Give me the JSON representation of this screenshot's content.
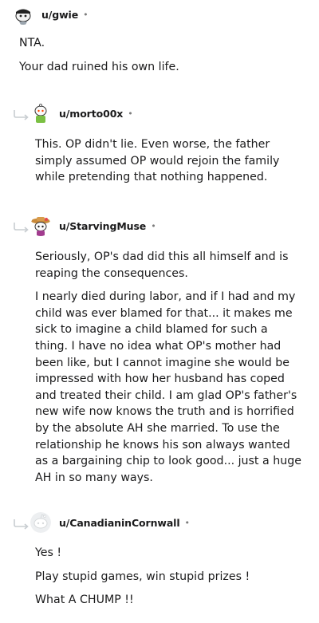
{
  "comments": [
    {
      "username": "u/gwie",
      "separator": "•",
      "avatar_icon": "snoo-bandana-avatar-icon",
      "paragraphs": [
        "NTA.",
        "Your dad ruined his own life."
      ]
    },
    {
      "username": "u/morto00x",
      "separator": "•",
      "avatar_icon": "snoo-green-shirt-avatar-icon",
      "paragraphs": [
        "This. OP didn't lie. Even worse, the father simply assumed OP would rejoin the family while pretending that nothing happened."
      ]
    },
    {
      "username": "u/StarvingMuse",
      "separator": "•",
      "avatar_icon": "snoo-hat-avatar-icon",
      "paragraphs": [
        "Seriously, OP's dad did this all himself and is reaping the consequences.",
        "I nearly died during labor, and if I had and my child was ever blamed for that... it makes me sick to imagine a child blamed for such a thing. I have no idea what OP's mother had been like, but I cannot imagine she would be impressed with how her husband has coped and treated their child. I am glad OP's father's new wife now knows the truth and is horrified by the absolute AH she married. To use the relationship he knows his son always wanted as a bargaining chip to look good... just a huge AH in so many ways."
      ]
    },
    {
      "username": "u/CanadianinCornwall",
      "separator": "•",
      "avatar_icon": "default-snoo-avatar-icon",
      "paragraphs": [
        "Yes !",
        "Play stupid games, win stupid prizes !",
        "What A CHUMP !!"
      ]
    }
  ]
}
